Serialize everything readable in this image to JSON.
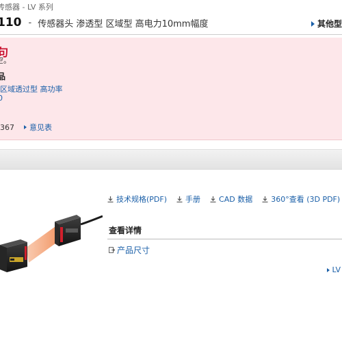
{
  "breadcrumb": "传感器 - LV 系列",
  "header": {
    "model": "110",
    "dash": "-",
    "description": "传感器头 渗透型 区域型 高电力10mm幅度",
    "other_models": "其他型"
  },
  "notice": {
    "title": "句",
    "line1": "空。",
    "subtitle": "品",
    "product_link": "区域透过型 高功率",
    "code": "0",
    "phone_suffix": "-367",
    "feedback_link": "意见表"
  },
  "downloads": [
    {
      "label": "技术规格(PDF)",
      "icon": "download-icon"
    },
    {
      "label": "手册",
      "icon": "download-icon"
    },
    {
      "label": "CAD 数据",
      "icon": "download-icon"
    },
    {
      "label": "360°查看 (3D PDF)",
      "icon": "download-icon"
    }
  ],
  "details": {
    "title": "查看详情",
    "dimensions_link": "产品尺寸"
  },
  "right_link": "LV",
  "colors": {
    "link": "#1a5fa8",
    "notice_bg": "#fde7ea",
    "notice_title": "#c8102e",
    "beam": "#f08a4b"
  }
}
